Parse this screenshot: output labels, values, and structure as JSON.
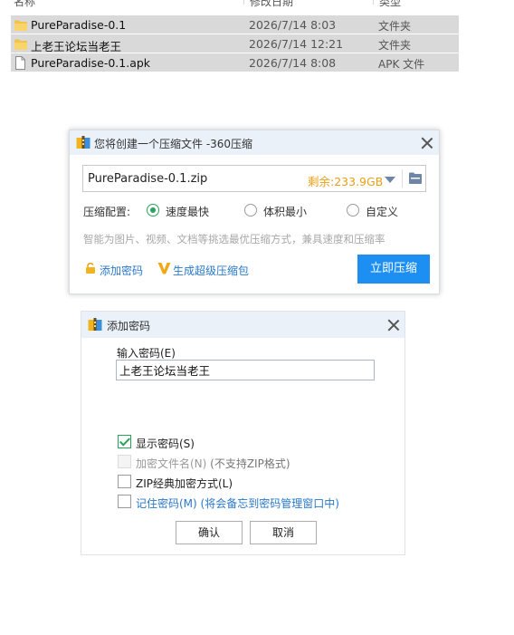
{
  "file_list": {
    "headers": [
      "名称",
      "修改日期",
      "类型"
    ],
    "rows": [
      {
        "name": "PureParadise-0.1",
        "date": "2026/7/14 8:03",
        "type": "文件夹",
        "icon": "folder-icon"
      },
      {
        "name": "上老王论坛当老王",
        "date": "2026/7/14 12:21",
        "type": "文件夹",
        "icon": "folder-icon"
      },
      {
        "name": "PureParadise-0.1.apk",
        "date": "2026/7/14 8:08",
        "type": "APK 文件",
        "icon": "file-icon"
      }
    ]
  },
  "compress_dialog": {
    "title": "您将创建一个压缩文件 -360压缩",
    "path": "PureParadise-0.1.zip",
    "free_space": "剩余:233.9GB",
    "config_label": "压缩配置:",
    "options": [
      {
        "label": "速度最快",
        "checked": true
      },
      {
        "label": "体积最小",
        "checked": false
      },
      {
        "label": "自定义",
        "checked": false
      }
    ],
    "hint": "智能为图片、视频、文档等挑选最优压缩方式，兼具速度和压缩率",
    "add_password_label": "添加密码",
    "super_pack_label": "生成超级压缩包",
    "compress_button": "立即压缩"
  },
  "password_dialog": {
    "title": "添加密码",
    "input_label": "输入密码(E)",
    "password_value": "上老王论坛当老王",
    "checkboxes": [
      {
        "label": "显示密码(S)",
        "note": "",
        "checked": true,
        "disabled": false
      },
      {
        "label": "加密文件名(N)",
        "note": " (不支持ZIP格式)",
        "checked": false,
        "disabled": true
      },
      {
        "label": "ZIP经典加密方式(L)",
        "note": "",
        "checked": false,
        "disabled": false
      },
      {
        "label": "记住密码(M)",
        "note": " (将会备忘到密码管理窗口中)",
        "checked": false,
        "disabled": false
      }
    ],
    "ok_button": "确认",
    "cancel_button": "取消"
  },
  "colors": {
    "accent_blue": "#1d8ff2",
    "link_blue": "#2a78c9",
    "free_space_orange": "#e8a019",
    "check_green": "#2aa25a",
    "selection_gray": "#d9d9d9"
  }
}
